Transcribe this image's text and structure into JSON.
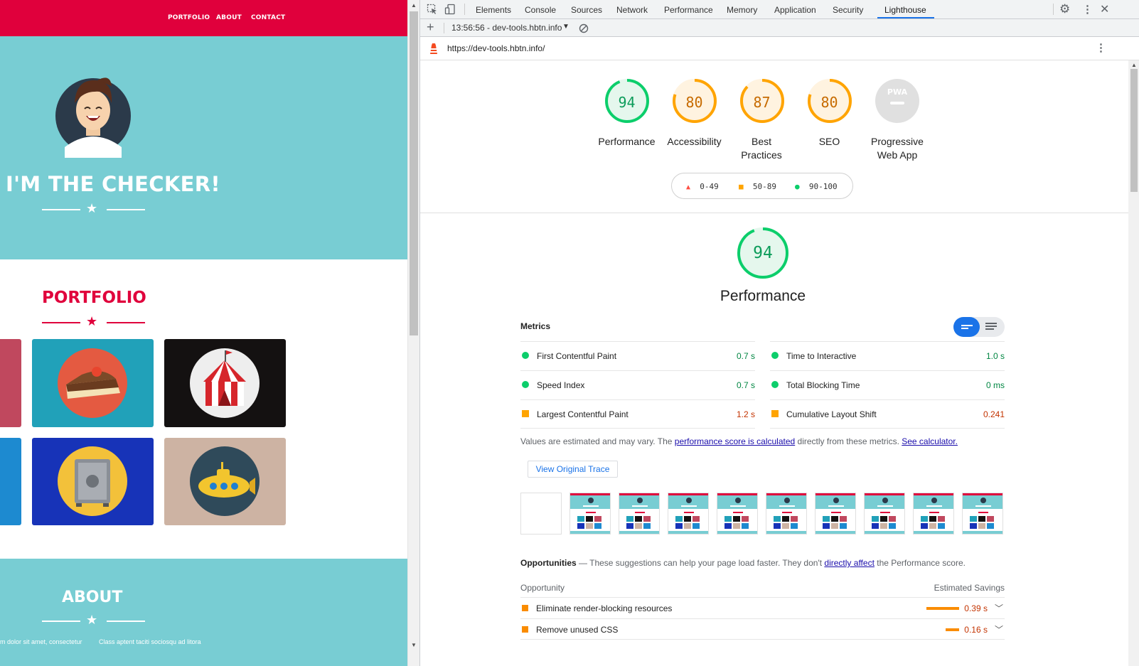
{
  "site": {
    "nav": [
      "PORTFOLIO",
      "ABOUT",
      "CONTACT"
    ],
    "hero_title": "I'M THE CHECKER!",
    "portfolio_title": "PORTFOLIO",
    "about_title": "ABOUT",
    "about_text_left": "m dolor sit amet, consectetur",
    "about_text_right": "Class aptent taciti sociosqu ad litora",
    "colors": {
      "brand": "#e0003c",
      "teal": "#78cdd3"
    }
  },
  "devtools": {
    "tabs": [
      "Elements",
      "Console",
      "Sources",
      "Network",
      "Performance",
      "Memory",
      "Application",
      "Security",
      "Lighthouse"
    ],
    "active_tab": "Lighthouse",
    "report_select": "13:56:56 - dev-tools.hbtn.info",
    "url": "https://dev-tools.hbtn.info/"
  },
  "lighthouse": {
    "categories": [
      {
        "label": "Performance",
        "score": "94",
        "level": 0.94,
        "color": "#0cce6b",
        "text_color": "#0c9c5a"
      },
      {
        "label": "Accessibility",
        "score": "80",
        "level": 0.8,
        "color": "#ffa400",
        "text_color": "#c76b00"
      },
      {
        "label": "Best Practices",
        "score": "87",
        "level": 0.87,
        "color": "#ffa400",
        "text_color": "#c76b00"
      },
      {
        "label": "SEO",
        "score": "80",
        "level": 0.8,
        "color": "#ffa400",
        "text_color": "#c76b00"
      },
      {
        "label": "Progressive Web App",
        "score": "PWA"
      }
    ],
    "legend": [
      "0-49",
      "50-89",
      "90-100"
    ],
    "perf_score": "94",
    "perf_title": "Performance",
    "metrics_title": "Metrics",
    "metrics": [
      {
        "name": "First Contentful Paint",
        "value": "0.7 s",
        "status": "pass"
      },
      {
        "name": "Time to Interactive",
        "value": "1.0 s",
        "status": "pass"
      },
      {
        "name": "Speed Index",
        "value": "0.7 s",
        "status": "pass"
      },
      {
        "name": "Total Blocking Time",
        "value": "0 ms",
        "status": "pass"
      },
      {
        "name": "Largest Contentful Paint",
        "value": "1.2 s",
        "status": "average"
      },
      {
        "name": "Cumulative Layout Shift",
        "value": "0.241",
        "status": "average"
      }
    ],
    "note_prefix": "Values are estimated and may vary. The ",
    "note_link1": "performance score is calculated",
    "note_mid": " directly from these metrics. ",
    "note_link2": "See calculator.",
    "trace_button": "View Original Trace",
    "opps_title": "Opportunities",
    "opps_text_prefix": " — These suggestions can help your page load faster. They don't ",
    "opps_link": "directly affect",
    "opps_text_suffix": " the Performance score.",
    "opp_col_left": "Opportunity",
    "opp_col_right": "Estimated Savings",
    "opportunities": [
      {
        "name": "Eliminate render-blocking resources",
        "savings": "0.39 s",
        "level": 1.0
      },
      {
        "name": "Remove unused CSS",
        "savings": "0.16 s",
        "level": 0.41
      }
    ]
  }
}
